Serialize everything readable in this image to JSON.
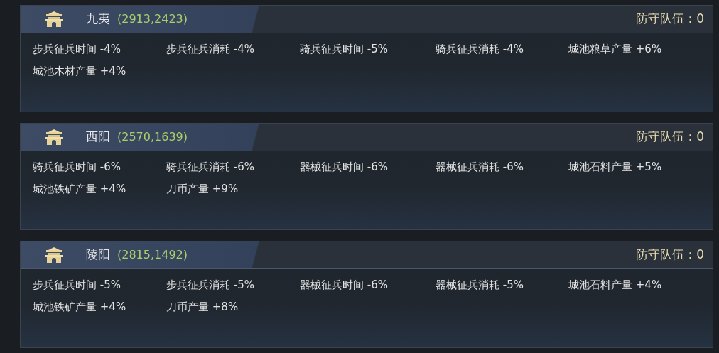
{
  "cities": [
    {
      "name": "九夷",
      "coords": "(2913,2423)",
      "defense": "防守队伍：0",
      "effects": [
        "步兵征兵时间 -4%",
        "步兵征兵消耗 -4%",
        "骑兵征兵时间 -5%",
        "骑兵征兵消耗 -4%",
        "城池粮草产量 +6%",
        "城池木材产量 +4%"
      ]
    },
    {
      "name": "西阳",
      "coords": "(2570,1639)",
      "defense": "防守队伍：0",
      "effects": [
        "骑兵征兵时间 -6%",
        "骑兵征兵消耗 -6%",
        "器械征兵时间 -6%",
        "器械征兵消耗 -6%",
        "城池石料产量 +5%",
        "城池铁矿产量 +4%",
        "刀币产量 +9%"
      ]
    },
    {
      "name": "陵阳",
      "coords": "(2815,1492)",
      "defense": "防守队伍：0",
      "effects": [
        "步兵征兵时间 -5%",
        "步兵征兵消耗 -5%",
        "器械征兵时间 -6%",
        "器械征兵消耗 -5%",
        "城池石料产量 +4%",
        "城池铁矿产量 +4%",
        "刀币产量 +8%"
      ]
    }
  ]
}
